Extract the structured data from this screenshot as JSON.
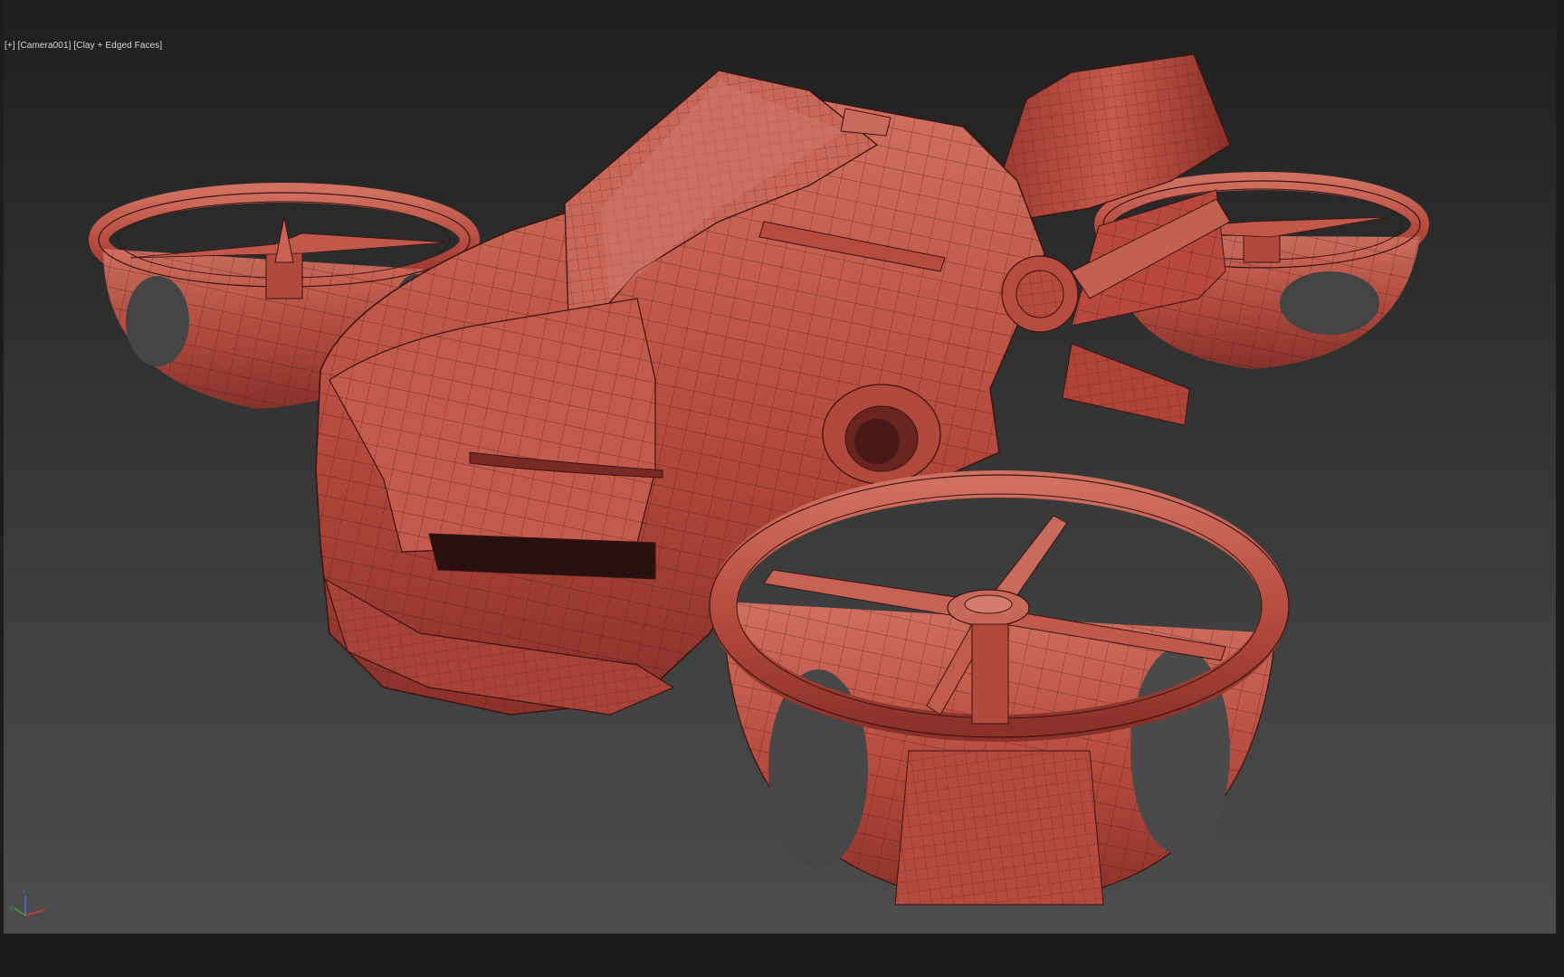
{
  "viewport": {
    "label": {
      "plus": "[+]",
      "camera": "[Camera001]",
      "shading": "[Clay + Edged Faces]"
    },
    "axis_gizmo": {
      "x_label": "x",
      "y_label": "y",
      "z_label": "z",
      "x_color": "#d03a2e",
      "y_color": "#3aa63a",
      "z_color": "#3f6fd8"
    }
  },
  "colors": {
    "clay": "#b8483d",
    "clay_light": "#cf6a5c",
    "clay_dark": "#7a2a24",
    "wire": "#3a1412"
  },
  "icons": {
    "axis_gizmo": "axis-tripod-icon"
  }
}
